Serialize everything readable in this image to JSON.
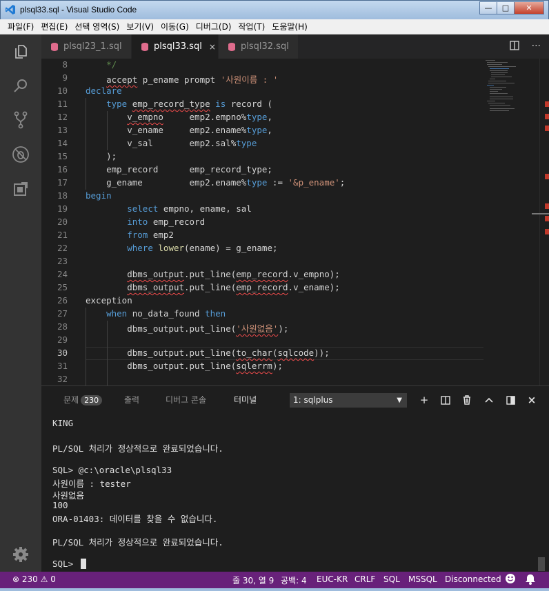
{
  "window": {
    "title": "plsql33.sql - Visual Studio Code",
    "minimize_glyph": "—",
    "maximize_glyph": "□",
    "close_glyph": "✕"
  },
  "menu": [
    "파일(F)",
    "편집(E)",
    "선택 영역(S)",
    "보기(V)",
    "이동(G)",
    "디버그(D)",
    "작업(T)",
    "도움말(H)"
  ],
  "activity_icons": [
    "explorer-icon",
    "search-icon",
    "source-control-icon",
    "debug-icon",
    "extensions-icon",
    "gear-icon"
  ],
  "tabs": [
    {
      "label": "plsql23_1.sql",
      "active": false
    },
    {
      "label": "plsql33.sql",
      "active": true,
      "close": "×"
    },
    {
      "label": "plsql32.sql",
      "active": false
    }
  ],
  "editor_actions": {
    "split": "split-editor-icon",
    "more": "···"
  },
  "editor": {
    "line_numbers": [
      "8",
      "9",
      "10",
      "11",
      "12",
      "13",
      "14",
      "15",
      "16",
      "17",
      "18",
      "19",
      "20",
      "21",
      "22",
      "23",
      "24",
      "25",
      "26",
      "27",
      "28",
      "29",
      "30",
      "31",
      "32"
    ],
    "current_line": "30",
    "lines": [
      [
        {
          "t": "    "
        },
        {
          "t": "*/",
          "c": "cm"
        }
      ],
      [
        {
          "t": "    "
        },
        {
          "t": "accept",
          "c": "sq"
        },
        {
          "t": " p_ename prompt "
        },
        {
          "t": "'사원이름 : '",
          "c": "str"
        }
      ],
      [
        {
          "t": "declare",
          "c": "kw"
        }
      ],
      [
        {
          "t": "    "
        },
        {
          "t": "type",
          "c": "kw"
        },
        {
          "t": " "
        },
        {
          "t": "emp_record_type",
          "c": "sq"
        },
        {
          "t": " "
        },
        {
          "t": "is",
          "c": "kw"
        },
        {
          "t": " record ("
        }
      ],
      [
        {
          "t": "        "
        },
        {
          "t": "v_empno",
          "c": "sq"
        },
        {
          "t": "     emp2.empno%"
        },
        {
          "t": "type",
          "c": "kw"
        },
        {
          "t": ","
        }
      ],
      [
        {
          "t": "        v_ename     emp2.ename%"
        },
        {
          "t": "type",
          "c": "kw"
        },
        {
          "t": ","
        }
      ],
      [
        {
          "t": "        v_sal       emp2.sal%"
        },
        {
          "t": "type",
          "c": "kw"
        }
      ],
      [
        {
          "t": "    );"
        }
      ],
      [
        {
          "t": "    emp_record      emp_record_type;"
        }
      ],
      [
        {
          "t": "    g_ename         emp2.ename%"
        },
        {
          "t": "type",
          "c": "kw"
        },
        {
          "t": " := "
        },
        {
          "t": "'&p_ename'",
          "c": "str"
        },
        {
          "t": ";"
        }
      ],
      [
        {
          "t": "begin",
          "c": "kw"
        }
      ],
      [
        {
          "t": "        "
        },
        {
          "t": "select",
          "c": "kw"
        },
        {
          "t": " empno, ename, sal"
        }
      ],
      [
        {
          "t": "        "
        },
        {
          "t": "into",
          "c": "kw"
        },
        {
          "t": " emp_record"
        }
      ],
      [
        {
          "t": "        "
        },
        {
          "t": "from",
          "c": "kw"
        },
        {
          "t": " emp2"
        }
      ],
      [
        {
          "t": "        "
        },
        {
          "t": "where",
          "c": "kw"
        },
        {
          "t": " "
        },
        {
          "t": "lower",
          "c": "fn"
        },
        {
          "t": "(ename) = g_ename;"
        }
      ],
      [
        {
          "t": ""
        }
      ],
      [
        {
          "t": "        "
        },
        {
          "t": "dbms_output",
          "c": "sq"
        },
        {
          "t": ".put_line("
        },
        {
          "t": "emp_record",
          "c": "sq"
        },
        {
          "t": ".v_empno);"
        }
      ],
      [
        {
          "t": "        "
        },
        {
          "t": "dbms_output",
          "c": "sq"
        },
        {
          "t": ".put_line("
        },
        {
          "t": "emp_record",
          "c": "sq"
        },
        {
          "t": ".v_ename);"
        }
      ],
      [
        {
          "t": "exception"
        }
      ],
      [
        {
          "t": "    "
        },
        {
          "t": "when",
          "c": "kw"
        },
        {
          "t": " no_data_found "
        },
        {
          "t": "then",
          "c": "kw"
        }
      ],
      [
        {
          "t": "        dbms_output.put_line("
        },
        {
          "t": "'사원없음'",
          "c": "str sq"
        },
        {
          "t": ");"
        }
      ],
      [
        {
          "t": ""
        }
      ],
      [
        {
          "t": "        dbms_output.put_line("
        },
        {
          "t": "to_char",
          "c": "sq"
        },
        {
          "t": "("
        },
        {
          "t": "sqlcode",
          "c": "sq"
        },
        {
          "t": "));"
        }
      ],
      [
        {
          "t": "        dbms_output.put_line("
        },
        {
          "t": "sqlerrm",
          "c": "sq"
        },
        {
          "t": ");"
        }
      ],
      [
        {
          "t": ""
        }
      ]
    ]
  },
  "panel": {
    "tabs": [
      {
        "label": "문제",
        "badge": "230"
      },
      {
        "label": "출력"
      },
      {
        "label": "디버그 콘솔"
      },
      {
        "label": "터미널",
        "active": true
      }
    ],
    "terminal_select": "1: sqlplus",
    "actions": {
      "add": "+",
      "split": "split-terminal-icon",
      "trash": "trash-icon",
      "up": "chevron-up-icon",
      "max": "maximize-panel-icon",
      "close": "×"
    },
    "terminal_lines": [
      "KING",
      "",
      "PL/SQL 처리가 정상적으로 완료되었습니다.",
      "",
      "SQL> @c:\\oracle\\plsql33",
      "사원이름 : tester",
      "사원없음",
      "100",
      "ORA-01403: 데이터를 찾을 수 없습니다.",
      "",
      "PL/SQL 처리가 정상적으로 완료되었습니다.",
      "",
      "SQL> "
    ]
  },
  "status": {
    "errors": "230",
    "warnings": "0",
    "position": "줄 30, 열 9",
    "spaces": "공백: 4",
    "encoding": "EUC-KR",
    "eol": "CRLF",
    "language": "SQL",
    "db": "MSSQL",
    "connection": "Disconnected",
    "colors": {
      "status_bg": "#68217a",
      "keyword": "#569cd6",
      "string": "#ce9178",
      "comment": "#608b4e"
    }
  }
}
